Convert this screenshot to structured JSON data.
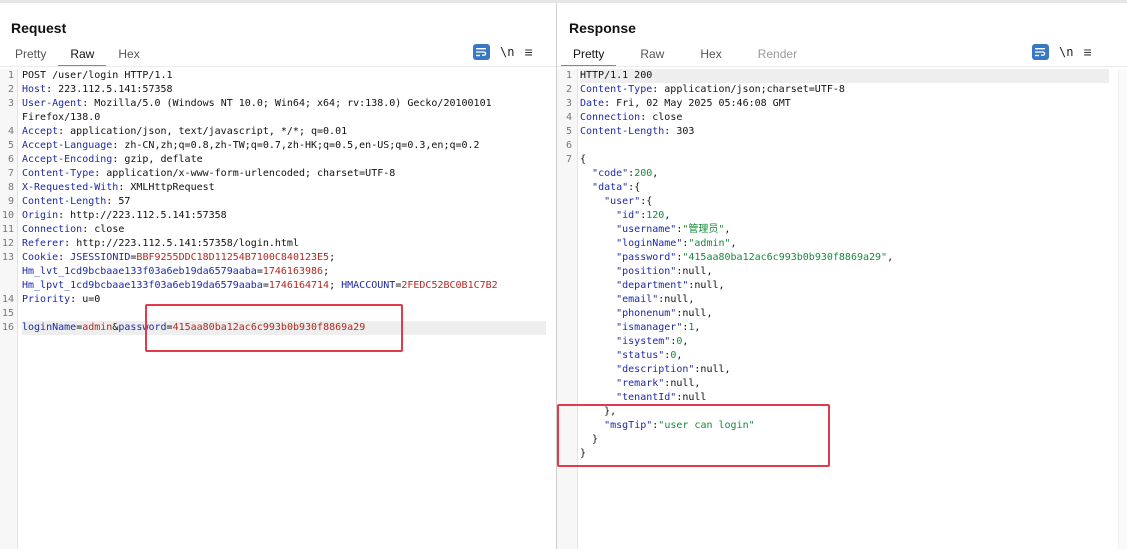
{
  "request": {
    "title": "Request",
    "tabs": [
      "Pretty",
      "Raw",
      "Hex"
    ],
    "active_tab": "Raw",
    "newline_label": "\\n",
    "menu_glyph": "≡",
    "lines": [
      {
        "n": "1",
        "segs": [
          [
            "POST /user/login HTTP/1.1",
            ""
          ]
        ]
      },
      {
        "n": "2",
        "segs": [
          [
            "Host",
            "hdr"
          ],
          [
            ": 223.112.5.141:57358",
            ""
          ]
        ]
      },
      {
        "n": "3",
        "segs": [
          [
            "User-Agent",
            "hdr"
          ],
          [
            ": Mozilla/5.0 (Windows NT 10.0; Win64; x64; rv:138.0) Gecko/20100101",
            ""
          ]
        ]
      },
      {
        "n": "",
        "segs": [
          [
            "Firefox/138.0",
            ""
          ]
        ]
      },
      {
        "n": "4",
        "segs": [
          [
            "Accept",
            "hdr"
          ],
          [
            ": application/json, text/javascript, */*; q=0.01",
            ""
          ]
        ]
      },
      {
        "n": "5",
        "segs": [
          [
            "Accept-Language",
            "hdr"
          ],
          [
            ": zh-CN,zh;q=0.8,zh-TW;q=0.7,zh-HK;q=0.5,en-US;q=0.3,en;q=0.2",
            ""
          ]
        ]
      },
      {
        "n": "6",
        "segs": [
          [
            "Accept-Encoding",
            "hdr"
          ],
          [
            ": gzip, deflate",
            ""
          ]
        ]
      },
      {
        "n": "7",
        "segs": [
          [
            "Content-Type",
            "hdr"
          ],
          [
            ": application/x-www-form-urlencoded; charset=UTF-8",
            ""
          ]
        ]
      },
      {
        "n": "8",
        "segs": [
          [
            "X-Requested-With",
            "hdr"
          ],
          [
            ": XMLHttpRequest",
            ""
          ]
        ]
      },
      {
        "n": "9",
        "segs": [
          [
            "Content-Length",
            "hdr"
          ],
          [
            ": 57",
            ""
          ]
        ]
      },
      {
        "n": "10",
        "segs": [
          [
            "Origin",
            "hdr"
          ],
          [
            ": http://223.112.5.141:57358",
            ""
          ]
        ]
      },
      {
        "n": "11",
        "segs": [
          [
            "Connection",
            "hdr"
          ],
          [
            ": close",
            ""
          ]
        ]
      },
      {
        "n": "12",
        "segs": [
          [
            "Referer",
            "hdr"
          ],
          [
            ": http://223.112.5.141:57358/login.html",
            ""
          ]
        ]
      },
      {
        "n": "13",
        "segs": [
          [
            "Cookie",
            "hdr"
          ],
          [
            ": ",
            ""
          ],
          [
            "JSESSIONID",
            "ckn"
          ],
          [
            "=",
            ""
          ],
          [
            "BBF9255DDC18D11254B7100C840123E5",
            "ckv"
          ],
          [
            ";",
            ""
          ]
        ]
      },
      {
        "n": "",
        "segs": [
          [
            "Hm_lvt_1cd9bcbaae133f03a6eb19da6579aaba",
            "ckn"
          ],
          [
            "=",
            ""
          ],
          [
            "1746163986",
            "ckv"
          ],
          [
            ";",
            ""
          ]
        ]
      },
      {
        "n": "",
        "segs": [
          [
            "Hm_lpvt_1cd9bcbaae133f03a6eb19da6579aaba",
            "ckn"
          ],
          [
            "=",
            ""
          ],
          [
            "1746164714",
            "ckv"
          ],
          [
            "; ",
            ""
          ],
          [
            "HMACCOUNT",
            "ckn"
          ],
          [
            "=",
            ""
          ],
          [
            "2FEDC52BC0B1C7B2",
            "ckv"
          ]
        ]
      },
      {
        "n": "14",
        "segs": [
          [
            "Priority",
            "hdr"
          ],
          [
            ": u=0",
            ""
          ]
        ]
      },
      {
        "n": "15",
        "segs": []
      },
      {
        "n": "16",
        "segs": [
          [
            "loginName",
            "ckn"
          ],
          [
            "=",
            ""
          ],
          [
            "admin",
            "ckv"
          ],
          [
            "&",
            ""
          ],
          [
            "password",
            "ckn"
          ],
          [
            "=",
            ""
          ],
          [
            "415aa80ba12ac6c993b0b930f8869a29",
            "ckv"
          ]
        ],
        "highlight": true
      }
    ]
  },
  "response": {
    "title": "Response",
    "tabs": [
      "Pretty",
      "Raw",
      "Hex",
      "Render"
    ],
    "active_tab": "Pretty",
    "disabled_tabs": [
      "Render"
    ],
    "newline_label": "\\n",
    "menu_glyph": "≡",
    "lines": [
      {
        "n": "1",
        "segs": [
          [
            "HTTP/1.1 200",
            ""
          ]
        ],
        "highlight": true
      },
      {
        "n": "2",
        "segs": [
          [
            "Content-Type",
            "hdr"
          ],
          [
            ": application/json;charset=UTF-8",
            ""
          ]
        ]
      },
      {
        "n": "3",
        "segs": [
          [
            "Date",
            "hdr"
          ],
          [
            ": Fri, 02 May 2025 05:46:08 GMT",
            ""
          ]
        ]
      },
      {
        "n": "4",
        "segs": [
          [
            "Connection",
            "hdr"
          ],
          [
            ": close",
            ""
          ]
        ]
      },
      {
        "n": "5",
        "segs": [
          [
            "Content-Length",
            "hdr"
          ],
          [
            ": 303",
            ""
          ]
        ]
      },
      {
        "n": "6",
        "segs": []
      },
      {
        "n": "7",
        "segs": [
          [
            "{",
            ""
          ]
        ]
      },
      {
        "n": "",
        "segs": [
          [
            "  ",
            ""
          ],
          [
            "\"code\"",
            "kkey"
          ],
          [
            ":",
            ""
          ],
          [
            "200",
            "str"
          ],
          [
            ",",
            ""
          ]
        ]
      },
      {
        "n": "",
        "segs": [
          [
            "  ",
            ""
          ],
          [
            "\"data\"",
            "kkey"
          ],
          [
            ":{",
            ""
          ]
        ]
      },
      {
        "n": "",
        "segs": [
          [
            "    ",
            ""
          ],
          [
            "\"user\"",
            "kkey"
          ],
          [
            ":{",
            ""
          ]
        ]
      },
      {
        "n": "",
        "segs": [
          [
            "      ",
            ""
          ],
          [
            "\"id\"",
            "kkey"
          ],
          [
            ":",
            ""
          ],
          [
            "120",
            "str"
          ],
          [
            ",",
            ""
          ]
        ]
      },
      {
        "n": "",
        "segs": [
          [
            "      ",
            ""
          ],
          [
            "\"username\"",
            "kkey"
          ],
          [
            ":",
            ""
          ],
          [
            "\"管理员\"",
            "str"
          ],
          [
            ",",
            ""
          ]
        ]
      },
      {
        "n": "",
        "segs": [
          [
            "      ",
            ""
          ],
          [
            "\"loginName\"",
            "kkey"
          ],
          [
            ":",
            ""
          ],
          [
            "\"admin\"",
            "str"
          ],
          [
            ",",
            ""
          ]
        ]
      },
      {
        "n": "",
        "segs": [
          [
            "      ",
            ""
          ],
          [
            "\"password\"",
            "kkey"
          ],
          [
            ":",
            ""
          ],
          [
            "\"415aa80ba12ac6c993b0b930f8869a29\"",
            "str"
          ],
          [
            ",",
            ""
          ]
        ]
      },
      {
        "n": "",
        "segs": [
          [
            "      ",
            ""
          ],
          [
            "\"position\"",
            "kkey"
          ],
          [
            ":null,",
            ""
          ]
        ]
      },
      {
        "n": "",
        "segs": [
          [
            "      ",
            ""
          ],
          [
            "\"department\"",
            "kkey"
          ],
          [
            ":null,",
            ""
          ]
        ]
      },
      {
        "n": "",
        "segs": [
          [
            "      ",
            ""
          ],
          [
            "\"email\"",
            "kkey"
          ],
          [
            ":null,",
            ""
          ]
        ]
      },
      {
        "n": "",
        "segs": [
          [
            "      ",
            ""
          ],
          [
            "\"phonenum\"",
            "kkey"
          ],
          [
            ":null,",
            ""
          ]
        ]
      },
      {
        "n": "",
        "segs": [
          [
            "      ",
            ""
          ],
          [
            "\"ismanager\"",
            "kkey"
          ],
          [
            ":",
            ""
          ],
          [
            "1",
            "str"
          ],
          [
            ",",
            ""
          ]
        ]
      },
      {
        "n": "",
        "segs": [
          [
            "      ",
            ""
          ],
          [
            "\"isystem\"",
            "kkey"
          ],
          [
            ":",
            ""
          ],
          [
            "0",
            "str"
          ],
          [
            ",",
            ""
          ]
        ]
      },
      {
        "n": "",
        "segs": [
          [
            "      ",
            ""
          ],
          [
            "\"status\"",
            "kkey"
          ],
          [
            ":",
            ""
          ],
          [
            "0",
            "str"
          ],
          [
            ",",
            ""
          ]
        ]
      },
      {
        "n": "",
        "segs": [
          [
            "      ",
            ""
          ],
          [
            "\"description\"",
            "kkey"
          ],
          [
            ":null,",
            ""
          ]
        ]
      },
      {
        "n": "",
        "segs": [
          [
            "      ",
            ""
          ],
          [
            "\"remark\"",
            "kkey"
          ],
          [
            ":null,",
            ""
          ]
        ]
      },
      {
        "n": "",
        "segs": [
          [
            "      ",
            ""
          ],
          [
            "\"tenantId\"",
            "kkey"
          ],
          [
            ":null",
            ""
          ]
        ]
      },
      {
        "n": "",
        "segs": [
          [
            "    },",
            ""
          ]
        ]
      },
      {
        "n": "",
        "segs": [
          [
            "    ",
            ""
          ],
          [
            "\"msgTip\"",
            "kkey"
          ],
          [
            ":",
            ""
          ],
          [
            "\"user can login\"",
            "str"
          ]
        ]
      },
      {
        "n": "",
        "segs": [
          [
            "  }",
            ""
          ]
        ]
      },
      {
        "n": "",
        "segs": [
          [
            "}",
            ""
          ]
        ]
      }
    ]
  },
  "colors": {
    "accent_tab": "#e8672c",
    "annotation_box": "#e03b4a",
    "header_name": "#1d2aa6",
    "cookie_value": "#b5271f",
    "json_value": "#158a3a"
  },
  "icons": [
    "wrap-lines-icon",
    "menu-icon",
    "layout-side-by-side-icon",
    "layout-stacked-icon",
    "layout-single-icon"
  ]
}
